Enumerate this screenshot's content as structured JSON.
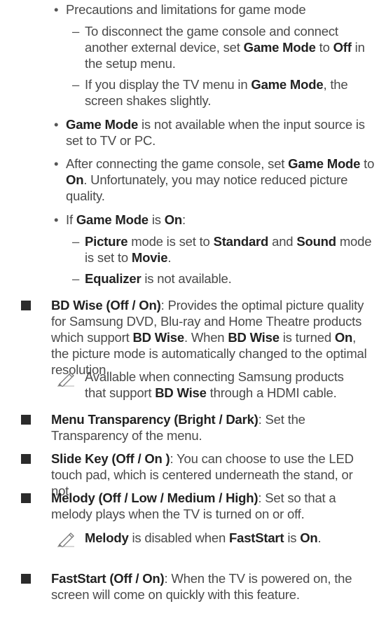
{
  "game_mode_section": {
    "heading": "Precautions and limitations for game mode",
    "sub1": {
      "pre": "To disconnect the game console and connect another external device, set ",
      "b1": "Game Mode",
      "mid": " to ",
      "b2": "Off",
      "post": " in the setup menu."
    },
    "sub2": {
      "pre": "If you display the TV menu in ",
      "b1": "Game Mode",
      "post": ", the screen shakes slightly."
    },
    "bullet2": {
      "b1": "Game Mode",
      "post": " is not available when the input source is set to TV or PC."
    },
    "bullet3": {
      "pre": "After connecting the game console, set ",
      "b1": "Game Mode",
      "mid": " to ",
      "b2": "On",
      "post": ". Unfortunately, you may notice reduced picture quality."
    },
    "bullet4": {
      "pre": "If ",
      "b1": "Game Mode",
      "mid": " is ",
      "b2": "On",
      "post": ":"
    },
    "sub3": {
      "b1": "Picture",
      "t1": " mode is set to ",
      "b2": "Standard",
      "t2": " and ",
      "b3": "Sound",
      "t3": " mode is set to ",
      "b4": "Movie",
      "t4": "."
    },
    "sub4": {
      "b1": "Equalizer",
      "post": " is not available."
    }
  },
  "bd_wise": {
    "label": "BD Wise (Off / On)",
    "t1": ": Provides the optimal picture quality for Samsung DVD, Blu-ray and Home Theatre products which support ",
    "b1": "BD Wise",
    "t2": ". When ",
    "b2": "BD Wise",
    "t3": " is turned ",
    "b3": "On",
    "t4": ", the picture mode is automatically changed to the optimal resolution.",
    "note": {
      "pre": "Available when connecting Samsung products that support ",
      "b1": "BD Wise",
      "post": " through a HDMI cable."
    }
  },
  "menu_transparency": {
    "label": "Menu Transparency (Bright / Dark)",
    "text": ": Set the Transparency of the menu."
  },
  "slide_key": {
    "label": "Slide Key (Off / On )",
    "text": ": You can choose to use the LED touch pad, which is centered underneath the stand, or not."
  },
  "melody": {
    "label": "Melody (Off / Low / Medium / High)",
    "text": ": Set so that a melody plays when the TV is turned on or off.",
    "note": {
      "b1": "Melody",
      "t1": " is disabled when ",
      "b2": "FastStart",
      "t2": " is ",
      "b3": "On",
      "t3": "."
    }
  },
  "faststart": {
    "label": "FastStart (Off / On)",
    "text": ": When the TV is powered on, the screen will come on quickly with this feature."
  },
  "icons": {
    "bullet_square": "square-bullet-icon",
    "note": "pencil-note-icon"
  },
  "colors": {
    "text": "#4a4a4a",
    "bold": "#222222",
    "bullet": "#2b2b2b"
  }
}
